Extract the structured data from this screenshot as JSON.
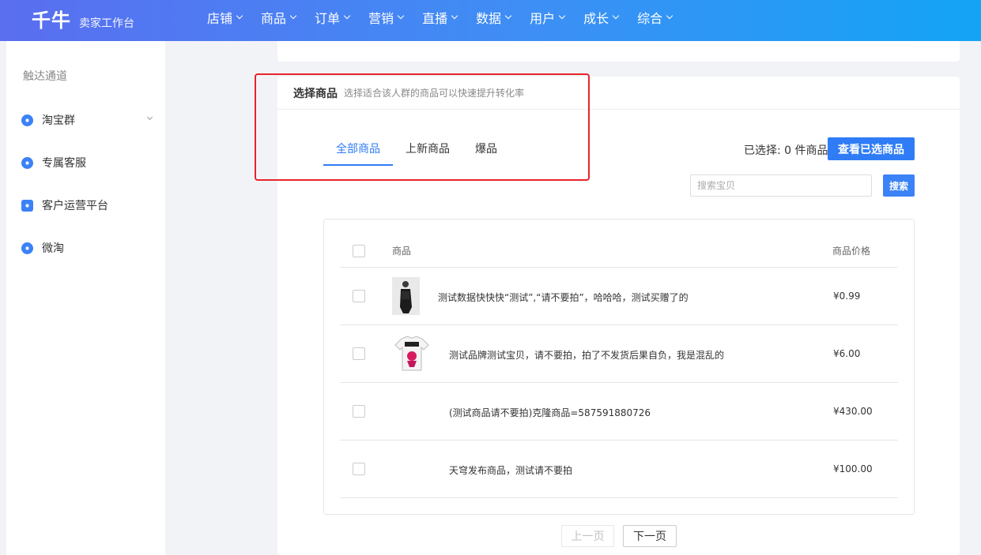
{
  "header": {
    "logo": "千牛",
    "logo_sub": "卖家工作台",
    "nav": [
      "店铺",
      "商品",
      "订单",
      "营销",
      "直播",
      "数据",
      "用户",
      "成长",
      "综合"
    ]
  },
  "sidebar": {
    "title": "触达通道",
    "items": [
      {
        "label": "淘宝群",
        "icon": "chat-bubble-icon"
      },
      {
        "label": "专属客服",
        "icon": "headset-icon"
      },
      {
        "label": "客户运营平台",
        "icon": "crosshair-icon"
      },
      {
        "label": "微淘",
        "icon": "broadcast-icon"
      }
    ]
  },
  "section": {
    "title": "选择商品",
    "subtitle": "选择适合该人群的商品可以快速提升转化率"
  },
  "tabs": [
    "全部商品",
    "上新商品",
    "爆品"
  ],
  "active_tab": "全部商品",
  "selection": {
    "text": "已选择: 0 件商品",
    "view_button": "查看已选商品"
  },
  "search": {
    "placeholder": "搜索宝贝",
    "button": "搜索"
  },
  "table": {
    "headers": {
      "product": "商品",
      "price": "商品价格"
    },
    "rows": [
      {
        "name": "测试数据快快快“测试”,“请不要拍”，哈哈哈，测试买赠了的",
        "price": "¥0.99",
        "image": "person-photo"
      },
      {
        "name": "测试品牌测试宝贝，请不要拍，拍了不发货后果自负，我是混乱的",
        "price": "¥6.00",
        "image": "tshirt-photo"
      },
      {
        "name": "(测试商品请不要拍)克隆商品=587591880726",
        "price": "¥430.00",
        "image": ""
      },
      {
        "name": "天穹发布商品，测试请不要拍",
        "price": "¥100.00",
        "image": ""
      }
    ]
  },
  "pagination": {
    "prev": "上一页",
    "next": "下一页"
  },
  "colors": {
    "accent": "#2f7cf6",
    "highlight": "#e8232a",
    "nav_start": "#5a6ef0",
    "nav_end": "#13a4f5"
  }
}
